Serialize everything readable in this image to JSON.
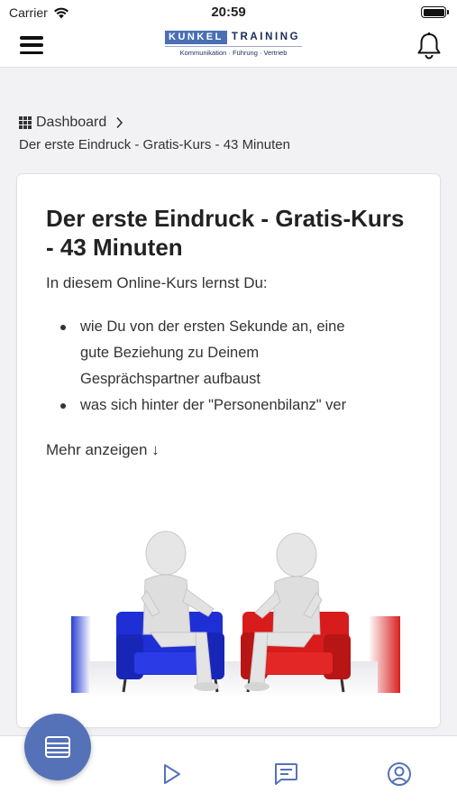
{
  "status_bar": {
    "carrier": "Carrier",
    "time": "20:59"
  },
  "header": {
    "logo_kunkel": "KUNKEL",
    "logo_training": "TRAINING",
    "logo_tagline": "Kommunikation · Führung · Vertrieb",
    "menu_icon": "hamburger-menu-icon",
    "notification_icon": "bell-icon"
  },
  "breadcrumb": {
    "root_label": "Dashboard",
    "root_icon": "grid-icon",
    "current": "Der erste Eindruck - Gratis-Kurs - 43 Minuten"
  },
  "course": {
    "title": "Der erste Eindruck - Gratis-Kurs - 43 Minuten",
    "intro": "In diesem Online-Kurs lernst Du:",
    "bullets": [
      "wie Du von der ersten Sekunde an, eine",
      "gute Beziehung zu Deinem",
      "Gesprächspartner aufbaust",
      "was sich hinter der \"Personenbilanz\" ver"
    ],
    "more_label": "Mehr anzeigen ↓"
  },
  "tab_bar": {
    "fab_icon": "course-list-icon",
    "tabs": [
      "play-icon",
      "chat-icon",
      "profile-icon"
    ]
  },
  "colors": {
    "accent": "#5572b8",
    "logo_blue": "#4a6fb5",
    "background": "#f2f1f4"
  }
}
